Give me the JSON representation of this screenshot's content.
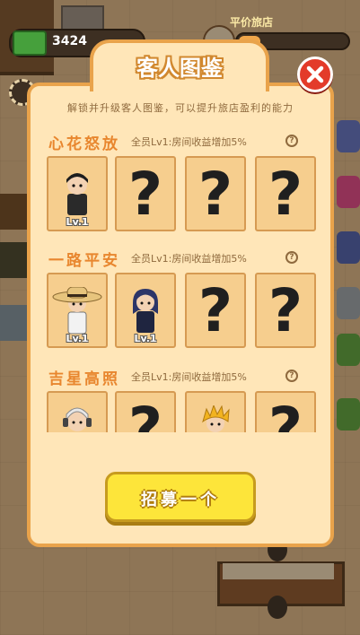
{
  "hud": {
    "cash_amount": "3424",
    "hotel_label": "平价旅店",
    "hotel_progress": 0.2
  },
  "dialog": {
    "title": "客人图鉴",
    "description": "解锁并升级客人图鉴，可以提升旅店盈利的能力",
    "groups": [
      {
        "name": "心花怒放",
        "bonus": "全员Lv1:房间收益增加5%",
        "cards": [
          {
            "unlocked": true,
            "level": "Lv.1",
            "avatar": "man-dark-hair"
          },
          {
            "unlocked": false,
            "placeholder": "?"
          },
          {
            "unlocked": false,
            "placeholder": "?"
          },
          {
            "unlocked": false,
            "placeholder": "?"
          }
        ]
      },
      {
        "name": "一路平安",
        "bonus": "全员Lv1:房间收益增加5%",
        "cards": [
          {
            "unlocked": true,
            "level": "Lv.1",
            "avatar": "man-straw-hat"
          },
          {
            "unlocked": true,
            "level": "Lv.1",
            "avatar": "woman-navy-hair"
          },
          {
            "unlocked": false,
            "placeholder": "?"
          },
          {
            "unlocked": false,
            "placeholder": "?"
          }
        ]
      },
      {
        "name": "吉星高照",
        "bonus": "全员Lv1:房间收益增加5%",
        "cards": [
          {
            "unlocked": true,
            "avatar": "headphone-kid"
          },
          {
            "unlocked": false,
            "placeholder": "?"
          },
          {
            "unlocked": true,
            "avatar": "spiky-blond-hair"
          },
          {
            "unlocked": false,
            "placeholder": "?"
          }
        ]
      }
    ],
    "recruit_button": "招募一个"
  },
  "colors": {
    "panel_bg": "#ffe6b8",
    "panel_border": "#e9a34b",
    "group_title": "#e8862e",
    "card_bg": "#f6ce8e",
    "button_yellow": "#fde53a",
    "close_red": "#e33b2a"
  }
}
